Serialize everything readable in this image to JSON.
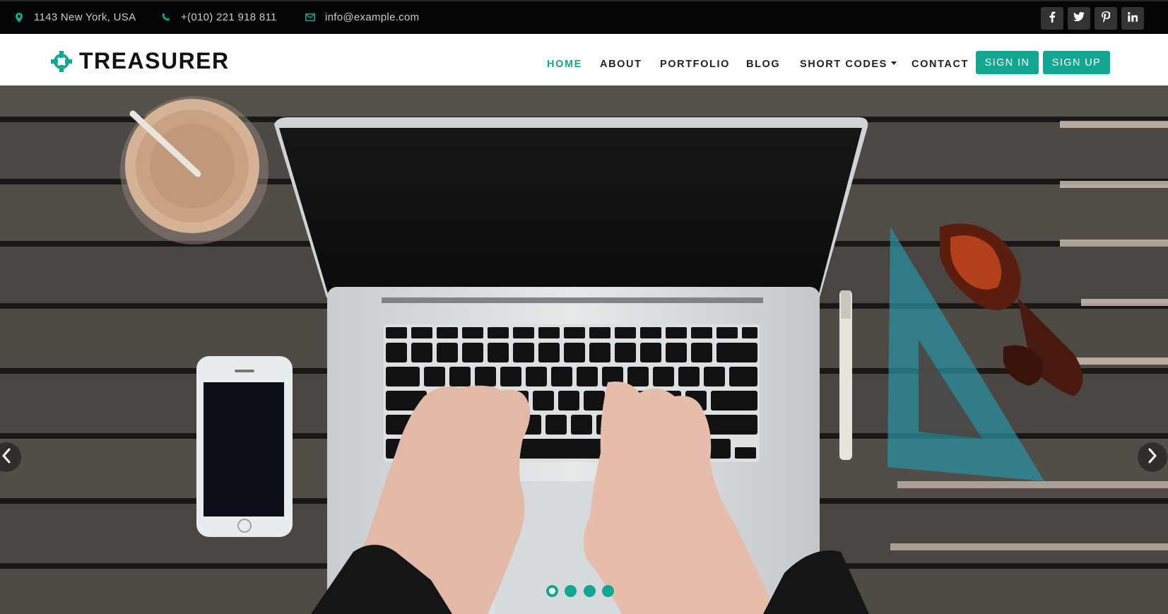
{
  "topbar": {
    "address": "1143 New York, USA",
    "phone": "+(010) 221 918 811",
    "email": "info@example.com",
    "icons": {
      "address": "map-marker-icon",
      "phone": "phone-icon",
      "email": "envelope-icon"
    },
    "social": [
      "facebook-icon",
      "twitter-icon",
      "pinterest-icon",
      "linkedin-icon"
    ]
  },
  "brand": {
    "name": "TREASURER",
    "icon": "crosshair-logo-icon"
  },
  "nav": {
    "items": [
      {
        "label": "HOME",
        "active": true
      },
      {
        "label": "ABOUT",
        "active": false
      },
      {
        "label": "PORTFOLIO",
        "active": false
      },
      {
        "label": "BLOG",
        "active": false
      },
      {
        "label": "SHORT CODES",
        "active": false,
        "dropdown": true
      },
      {
        "label": "CONTACT",
        "active": false
      }
    ],
    "sign_in": "SIGN IN",
    "sign_up": "SIGN UP"
  },
  "slider": {
    "slide_count": 4,
    "active_slide": 1,
    "prev_icon": "chevron-left-icon",
    "next_icon": "chevron-right-icon"
  },
  "colors": {
    "accent": "#12a58f",
    "topbar_bg": "#050505",
    "nav_text": "#222222",
    "button_text": "#ffffff"
  }
}
